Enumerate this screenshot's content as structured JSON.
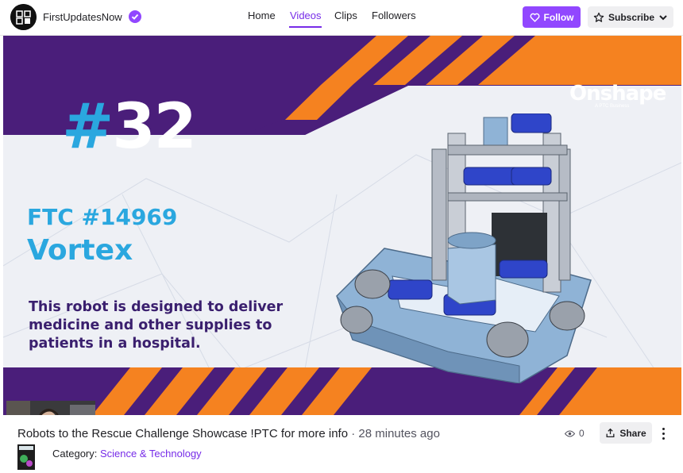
{
  "header": {
    "channel_name": "FirstUpdatesNow",
    "nav": [
      "Home",
      "Videos",
      "Clips",
      "Followers"
    ],
    "active_nav": "Videos",
    "follow_label": "Follow",
    "subscribe_label": "Subscribe"
  },
  "slide": {
    "number_hash": "#",
    "number": "32",
    "team": "FTC #14969",
    "robot_name": "Vortex",
    "description": "This robot is designed to deliver medicine and other supplies to patients in a hospital.",
    "sponsor": "Onshape",
    "sponsor_tagline": "A PTC Business"
  },
  "video": {
    "title": "Robots to the Rescue Challenge Showcase !PTC for more info",
    "separator": " · ",
    "time_ago": "28 minutes ago",
    "views": "0",
    "share_label": "Share",
    "category_label": "Category:",
    "category_value": "Science & Technology"
  },
  "colors": {
    "purple": "#4a1e7a",
    "orange": "#f58220",
    "cyan": "#2aa7df",
    "twitch_purple": "#9147ff"
  }
}
